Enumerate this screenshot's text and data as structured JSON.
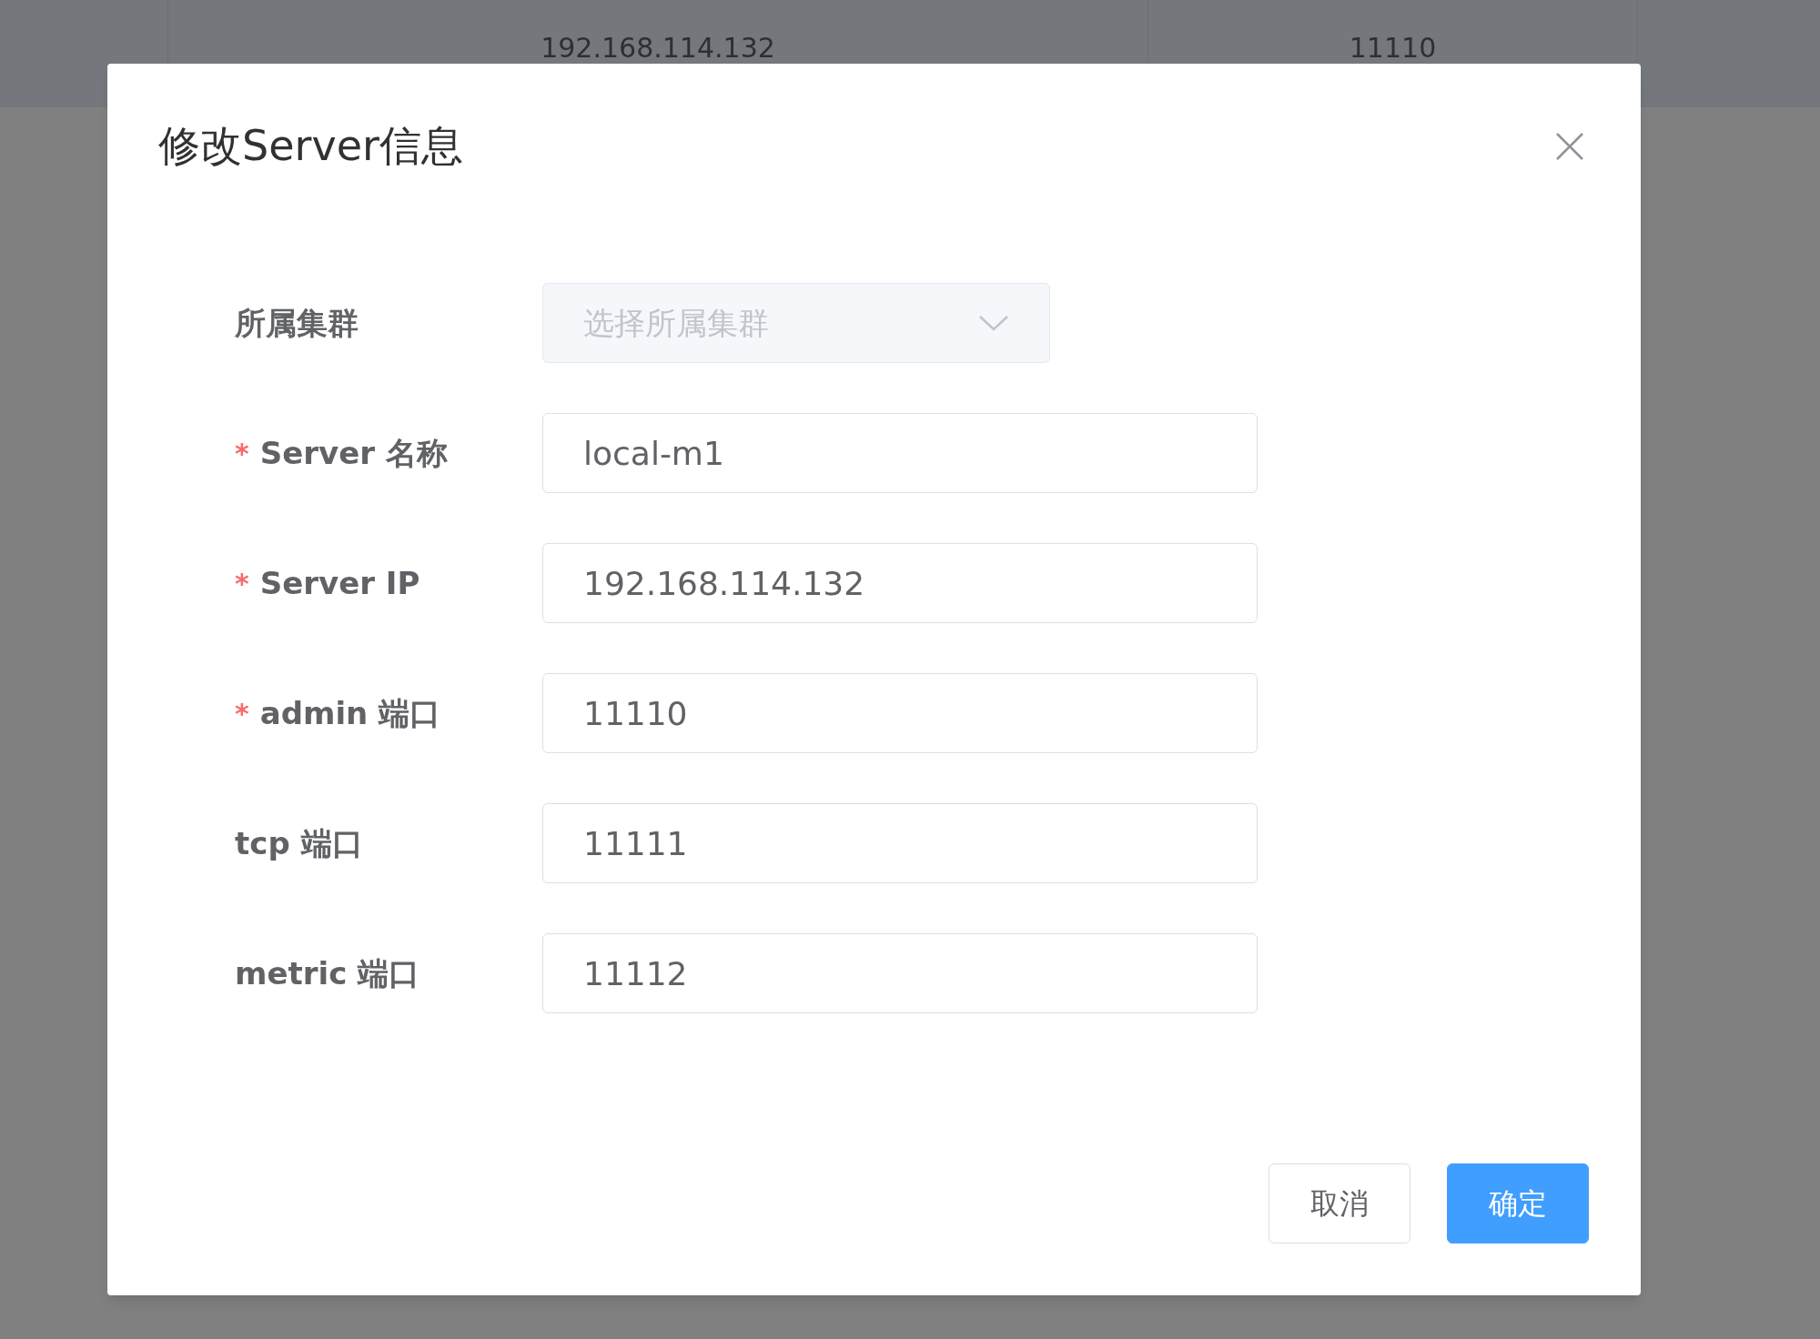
{
  "background_table": {
    "cells": [
      "192.168.114.132",
      "11110"
    ]
  },
  "dialog": {
    "title": "修改Server信息",
    "fields": [
      {
        "kind": "select",
        "label": "所属集群",
        "required": false,
        "disabled": true,
        "placeholder": "选择所属集群"
      },
      {
        "kind": "input",
        "label": "Server 名称",
        "required": true,
        "value": "local-m1"
      },
      {
        "kind": "input",
        "label": "Server IP",
        "required": true,
        "value": "192.168.114.132"
      },
      {
        "kind": "input",
        "label": "admin 端口",
        "required": true,
        "value": "11110"
      },
      {
        "kind": "input",
        "label": "tcp 端口",
        "required": false,
        "value": "11111"
      },
      {
        "kind": "input",
        "label": "metric 端口",
        "required": false,
        "value": "11112"
      }
    ],
    "required_mark": "*",
    "buttons": [
      {
        "label": "取消",
        "kind": "default"
      },
      {
        "label": "确定",
        "kind": "primary"
      }
    ]
  }
}
